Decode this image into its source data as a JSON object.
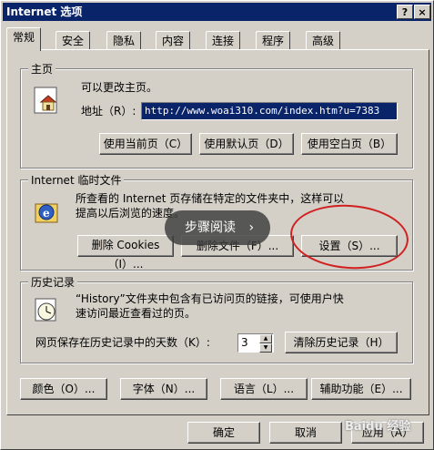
{
  "title": "Internet 选项",
  "titlebar_buttons": {
    "help": "?",
    "close": "×"
  },
  "tabs": [
    "常规",
    "安全",
    "隐私",
    "内容",
    "连接",
    "程序",
    "高级"
  ],
  "homepage": {
    "legend": "主页",
    "desc": "可以更改主页。",
    "address_label": "地址（R）:",
    "address_value": "http://www.woai310.com/index.htm?u=7383",
    "buttons": [
      "使用当前页（C）",
      "使用默认页（D）",
      "使用空白页（B）"
    ]
  },
  "temp_files": {
    "legend": "Internet 临时文件",
    "desc_line1": "所查看的 Internet 页存储在特定的文件夹中，这样可以",
    "desc_line2": "提高以后浏览的速度。",
    "buttons": [
      "删除 Cookies（I）...",
      "删除文件（F）...",
      "设置（S）..."
    ]
  },
  "history": {
    "legend": "历史记录",
    "desc_line1": "“History”文件夹中包含有已访问页的链接，可使用户快",
    "desc_line2": "速访问最近查看过的页。",
    "days_label": "网页保存在历史记录中的天数（K）:",
    "days_value": "3",
    "clear_button": "清除历史记录（H）"
  },
  "bottom_buttons": [
    "颜色（O）...",
    "字体（N）...",
    "语言（L）...",
    "辅助功能（E）..."
  ],
  "dialog_buttons": {
    "ok": "确定",
    "cancel": "取消",
    "apply": "应用（A）"
  },
  "overlay": {
    "label": "步骤阅读",
    "chevron": "›"
  },
  "watermark": "Baidu 经验"
}
